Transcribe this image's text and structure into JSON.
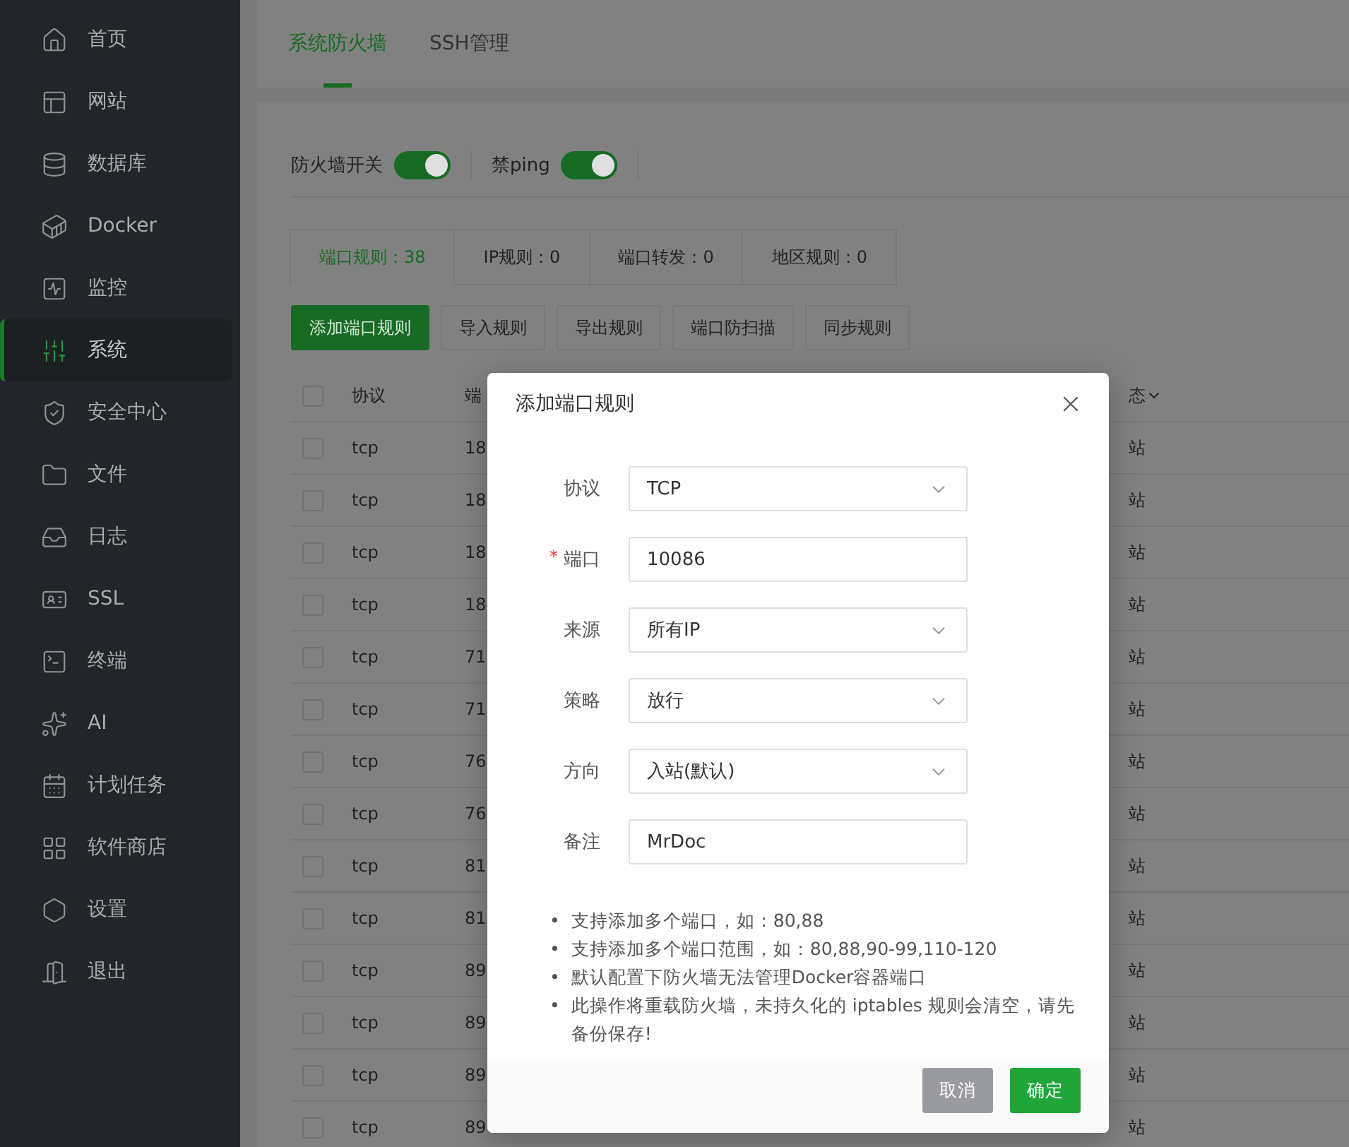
{
  "sidebar": {
    "items": [
      {
        "label": "首页",
        "selected": false
      },
      {
        "label": "网站",
        "selected": false
      },
      {
        "label": "数据库",
        "selected": false
      },
      {
        "label": "Docker",
        "selected": false
      },
      {
        "label": "监控",
        "selected": false
      },
      {
        "label": "系统",
        "selected": true
      },
      {
        "label": "安全中心",
        "selected": false
      },
      {
        "label": "文件",
        "selected": false
      },
      {
        "label": "日志",
        "selected": false
      },
      {
        "label": "SSL",
        "selected": false
      },
      {
        "label": "终端",
        "selected": false
      },
      {
        "label": "AI",
        "selected": false
      },
      {
        "label": "计划任务",
        "selected": false
      },
      {
        "label": "软件商店",
        "selected": false
      },
      {
        "label": "设置",
        "selected": false
      },
      {
        "label": "退出",
        "selected": false
      }
    ]
  },
  "tabs": [
    {
      "label": "系统防火墙",
      "selected": true
    },
    {
      "label": "SSH管理",
      "selected": false
    }
  ],
  "toggles": [
    {
      "label": "防火墙开关",
      "on": true
    },
    {
      "label": "禁ping",
      "on": true
    }
  ],
  "rule_tabs": [
    {
      "label": "端口规则：38",
      "selected": true
    },
    {
      "label": "IP规则：0",
      "selected": false
    },
    {
      "label": "端口转发：0",
      "selected": false
    },
    {
      "label": "地区规则：0",
      "selected": false
    }
  ],
  "toolbar_buttons": [
    {
      "label": "添加端口规则",
      "kind": "primary"
    },
    {
      "label": "导入规则",
      "kind": "default"
    },
    {
      "label": "导出规则",
      "kind": "default"
    },
    {
      "label": "端口防扫描",
      "kind": "default"
    },
    {
      "label": "同步规则",
      "kind": "default"
    }
  ],
  "table": {
    "columns": [
      "协议",
      "端",
      "态"
    ],
    "all_checked": false,
    "rows": [
      {
        "checked": false,
        "protocol": "tcp",
        "port": "18",
        "direction": "站"
      },
      {
        "checked": false,
        "protocol": "tcp",
        "port": "18",
        "direction": "站"
      },
      {
        "checked": false,
        "protocol": "tcp",
        "port": "18",
        "direction": "站"
      },
      {
        "checked": false,
        "protocol": "tcp",
        "port": "18",
        "direction": "站"
      },
      {
        "checked": false,
        "protocol": "tcp",
        "port": "71",
        "direction": "站"
      },
      {
        "checked": false,
        "protocol": "tcp",
        "port": "71",
        "direction": "站"
      },
      {
        "checked": false,
        "protocol": "tcp",
        "port": "76",
        "direction": "站"
      },
      {
        "checked": false,
        "protocol": "tcp",
        "port": "76",
        "direction": "站"
      },
      {
        "checked": false,
        "protocol": "tcp",
        "port": "81",
        "direction": "站"
      },
      {
        "checked": false,
        "protocol": "tcp",
        "port": "81",
        "direction": "站"
      },
      {
        "checked": false,
        "protocol": "tcp",
        "port": "89",
        "direction": "站"
      },
      {
        "checked": false,
        "protocol": "tcp",
        "port": "89",
        "direction": "站"
      },
      {
        "checked": false,
        "protocol": "tcp",
        "port": "89",
        "direction": "站"
      },
      {
        "checked": false,
        "protocol": "tcp",
        "port": "89",
        "direction": "站"
      }
    ]
  },
  "dialog": {
    "title": "添加端口规则",
    "required_mark": "*",
    "bullet": "•",
    "fields": [
      {
        "label": "协议",
        "kind": "select",
        "value": "TCP",
        "required": false
      },
      {
        "label": "端口",
        "kind": "input",
        "value": "10086",
        "required": true
      },
      {
        "label": "来源",
        "kind": "select",
        "value": "所有IP",
        "required": false
      },
      {
        "label": "策略",
        "kind": "select",
        "value": "放行",
        "required": false
      },
      {
        "label": "方向",
        "kind": "select",
        "value": "入站(默认)",
        "required": false
      },
      {
        "label": "备注",
        "kind": "input",
        "value": "MrDoc",
        "required": false
      }
    ],
    "notes": [
      "支持添加多个端口，如：80,88",
      "支持添加多个端口范围，如：80,88,90-99,110-120",
      "默认配置下防火墙无法管理Docker容器端口",
      "此操作将重载防火墙，未持久化的 iptables 规则会清空，请先备份保存!"
    ],
    "buttons": [
      {
        "label": "取消",
        "kind": "cancel"
      },
      {
        "label": "确定",
        "kind": "confirm"
      }
    ]
  }
}
